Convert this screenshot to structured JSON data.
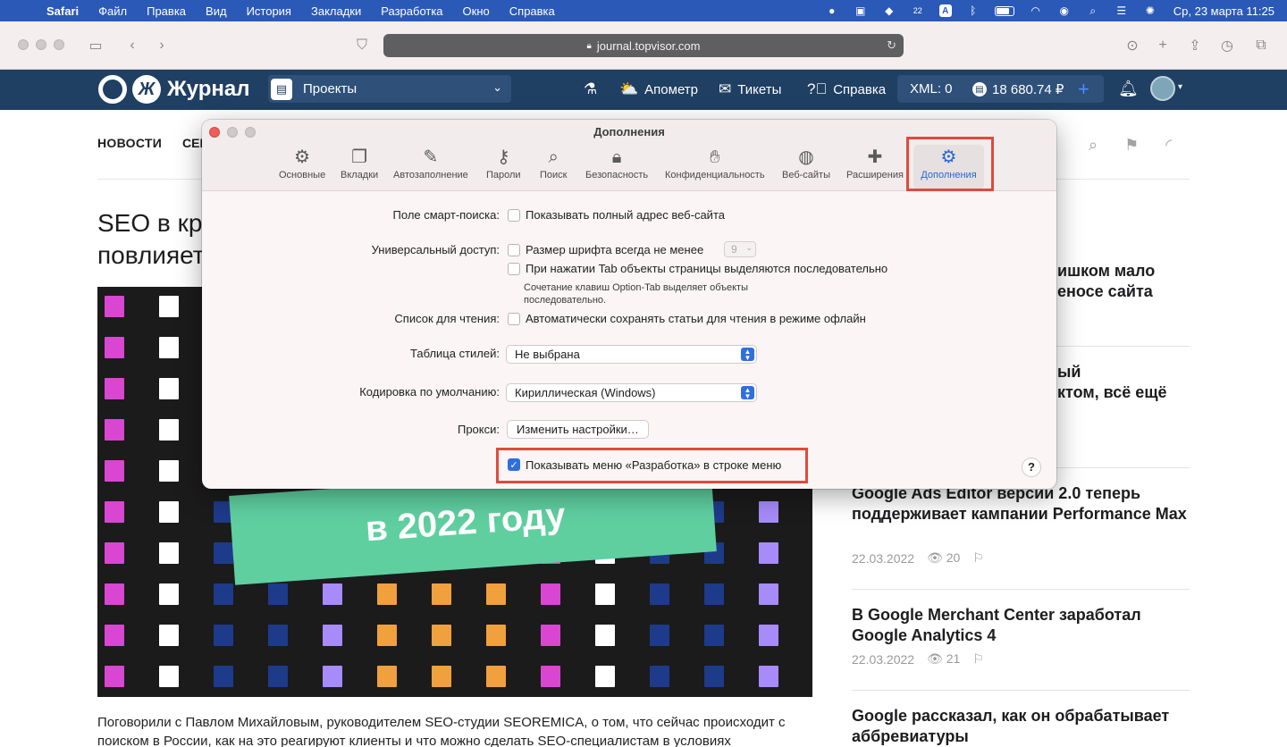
{
  "menubar": {
    "apple": "",
    "app": "Safari",
    "items": [
      "Файл",
      "Правка",
      "Вид",
      "История",
      "Закладки",
      "Разработка",
      "Окно",
      "Справка"
    ],
    "badge_count": "22",
    "input_source": "A",
    "clock": "Ср, 23 марта  11:25"
  },
  "browser": {
    "url": "journal.topvisor.com"
  },
  "site": {
    "logo_text": "Журнал",
    "projects_label": "Проекты",
    "nav": [
      "Апометр",
      "Тикеты",
      "Справка"
    ],
    "xml": "XML: 0",
    "balance": "18 680.74 ₽"
  },
  "page": {
    "nav_news": "НОВОСТИ",
    "nav_sek": "СЕК",
    "article_title_visible": "SEO в кр повлияет",
    "hero_text": "в 2022 году",
    "excerpt": "Поговорили с Павлом Михайловым, руководителем SEO-студии SEOREMICA, о том, что сейчас происходит с поиском в России, как на это реагируют клиенты и что можно сделать SEO-специалистам в условиях",
    "sidebar": [
      {
        "title": "...ишком мало ...еносе сайта",
        "date": "",
        "views": ""
      },
      {
        "title": "...ый ...ктом, всё ещё",
        "date": "",
        "views": ""
      },
      {
        "title": "Google Ads Editor версии 2.0 теперь поддерживает кампании Performance Max",
        "date": "22.03.2022",
        "views": "20"
      },
      {
        "title": "В Google Merchant Center заработал Google Analytics 4",
        "date": "22.03.2022",
        "views": "21"
      },
      {
        "title": "Google рассказал, как он обрабатывает аббревиатуры",
        "date": "",
        "views": ""
      }
    ]
  },
  "prefs": {
    "title": "Дополнения",
    "tabs": [
      "Основные",
      "Вкладки",
      "Автозаполнение",
      "Пароли",
      "Поиск",
      "Безопасность",
      "Конфиденциальность",
      "Веб-сайты",
      "Расширения",
      "Дополнения"
    ],
    "smart_search_label": "Поле смарт-поиска:",
    "smart_search_option": "Показывать полный адрес веб-сайта",
    "accessibility_label": "Универсальный доступ:",
    "font_size_option": "Размер шрифта всегда не менее",
    "font_size_value": "9",
    "tab_option": "При нажатии Tab объекты страницы выделяются последовательно",
    "tab_hint_1": "Сочетание клавиш Option-Tab выделяет объекты",
    "tab_hint_2": "последовательно.",
    "reading_list_label": "Список для чтения:",
    "reading_list_option": "Автоматически сохранять статьи для чтения в режиме офлайн",
    "stylesheet_label": "Таблица стилей:",
    "stylesheet_value": "Не выбрана",
    "encoding_label": "Кодировка по умолчанию:",
    "encoding_value": "Кириллическая (Windows)",
    "proxy_label": "Прокси:",
    "proxy_button": "Изменить настройки…",
    "develop_option": "Показывать меню «Разработка» в строке меню",
    "help": "?"
  }
}
